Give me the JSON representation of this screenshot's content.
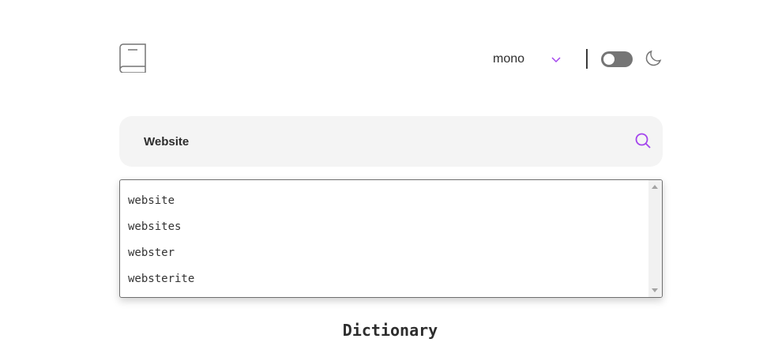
{
  "header": {
    "logo_icon": "book-icon",
    "font_selector": {
      "selected": "mono",
      "icon": "chevron-down-icon"
    },
    "theme_toggle": {
      "state": "off"
    },
    "theme_icon": "moon-icon"
  },
  "search": {
    "value": "Website",
    "icon": "search-icon"
  },
  "suggestions": [
    {
      "label": "website"
    },
    {
      "label": "websites"
    },
    {
      "label": "webster"
    },
    {
      "label": "websterite"
    }
  ],
  "main": {
    "title": "Dictionary"
  },
  "colors": {
    "accent": "#a445ed",
    "text": "#2d2d2d",
    "search_bg": "#f4f4f4",
    "toggle_bg": "#757575"
  }
}
